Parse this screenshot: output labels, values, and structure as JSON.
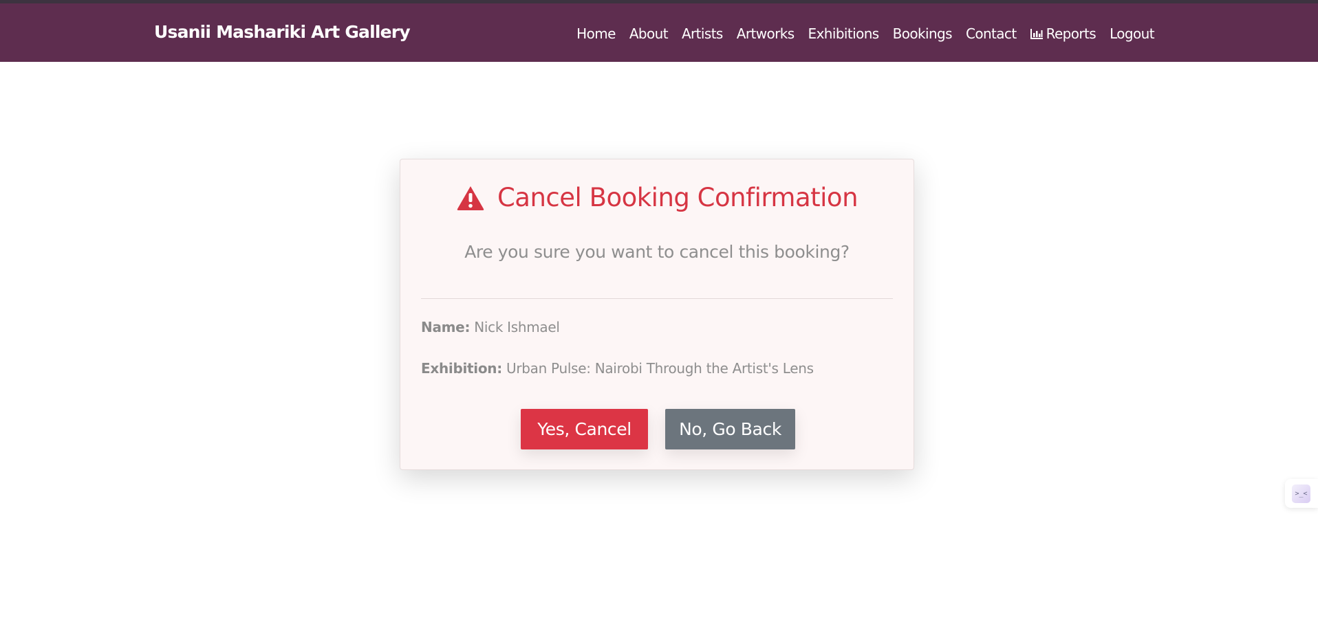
{
  "brand": "Usanii Mashariki Art Gallery",
  "nav": {
    "home": "Home",
    "about": "About",
    "artists": "Artists",
    "artworks": "Artworks",
    "exhibitions": "Exhibitions",
    "bookings": "Bookings",
    "contact": "Contact",
    "reports": "Reports",
    "logout": "Logout"
  },
  "dialog": {
    "title": "Cancel Booking Confirmation",
    "question": "Are you sure you want to cancel this booking?",
    "name_label": "Name:",
    "name_value": "Nick Ishmael",
    "exhibition_label": "Exhibition:",
    "exhibition_value": "Urban Pulse: Nairobi Through the Artist's Lens",
    "confirm_button": "Yes, Cancel",
    "back_button": "No, Go Back"
  },
  "widget": {
    "glyph": ">_<"
  },
  "colors": {
    "navbar": "#5e2d4f",
    "danger": "#dc3545",
    "secondary": "#6c757d",
    "card_bg": "#fdf6f6"
  },
  "icons": {
    "title_icon": "warning-triangle-icon",
    "reports_icon": "bar-chart-icon"
  }
}
